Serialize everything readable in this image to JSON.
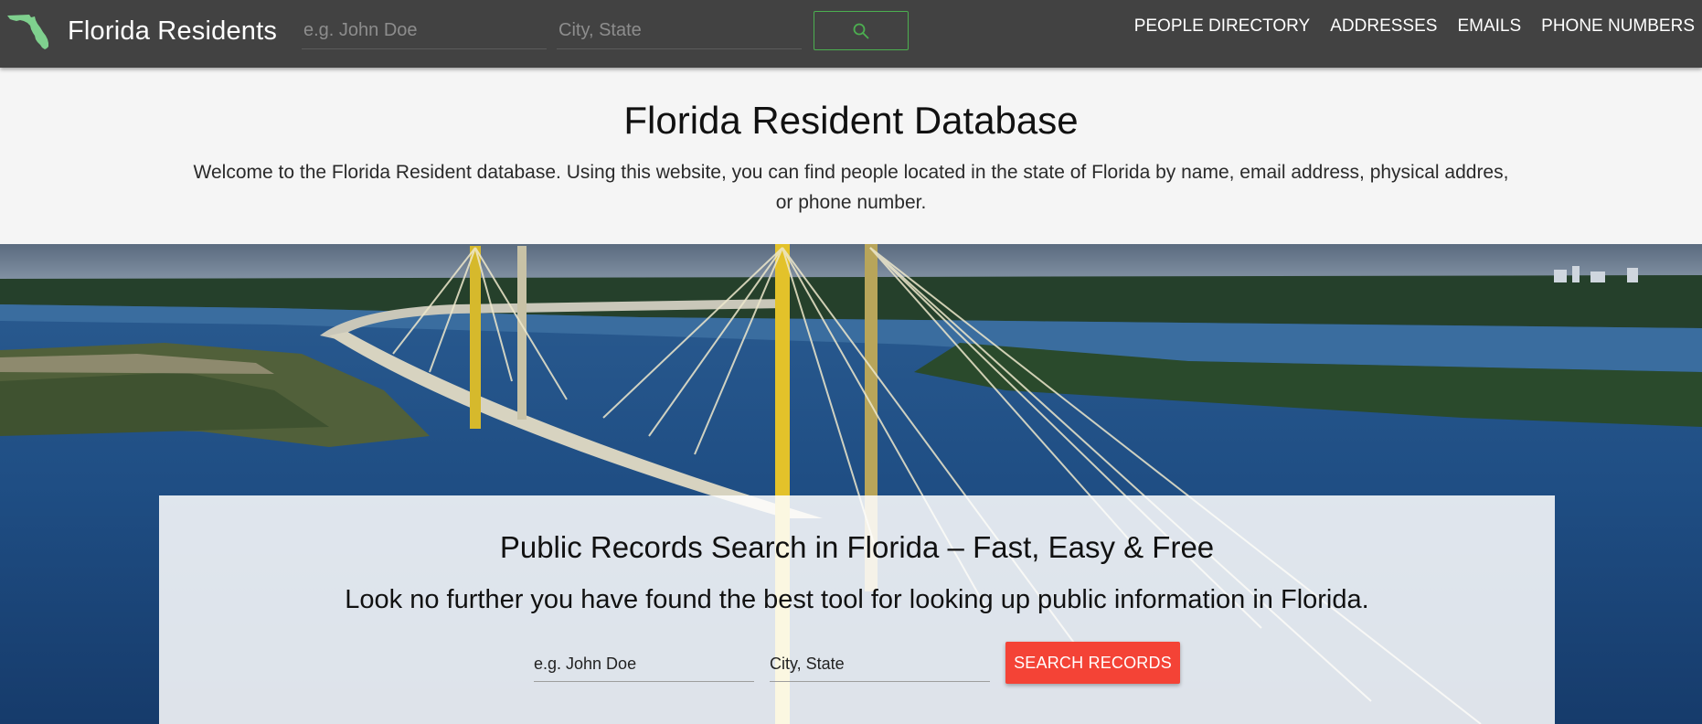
{
  "nav": {
    "brand": "Florida Residents",
    "name_placeholder": "e.g. John Doe",
    "location_placeholder": "City, State",
    "links": [
      "PEOPLE DIRECTORY",
      "ADDRESSES",
      "EMAILS",
      "PHONE NUMBERS"
    ]
  },
  "intro": {
    "title": "Florida Resident Database",
    "description": "Welcome to the Florida Resident database. Using this website, you can find people located in the state of Florida by name, email address, physical addres, or phone number."
  },
  "search_card": {
    "heading": "Public Records Search in Florida – Fast, Easy & Free",
    "subheading": "Look no further you have found the best tool for looking up public information in Florida.",
    "name_placeholder": "e.g. John Doe",
    "location_placeholder": "City, State",
    "button_label": "SEARCH RECORDS"
  },
  "colors": {
    "navbar": "#424242",
    "accent_green": "#4caf50",
    "button_red": "#f44336",
    "florida_icon": "#7fd08e"
  },
  "icons": {
    "brand_icon": "florida-state-icon",
    "nav_search": "search-icon"
  }
}
